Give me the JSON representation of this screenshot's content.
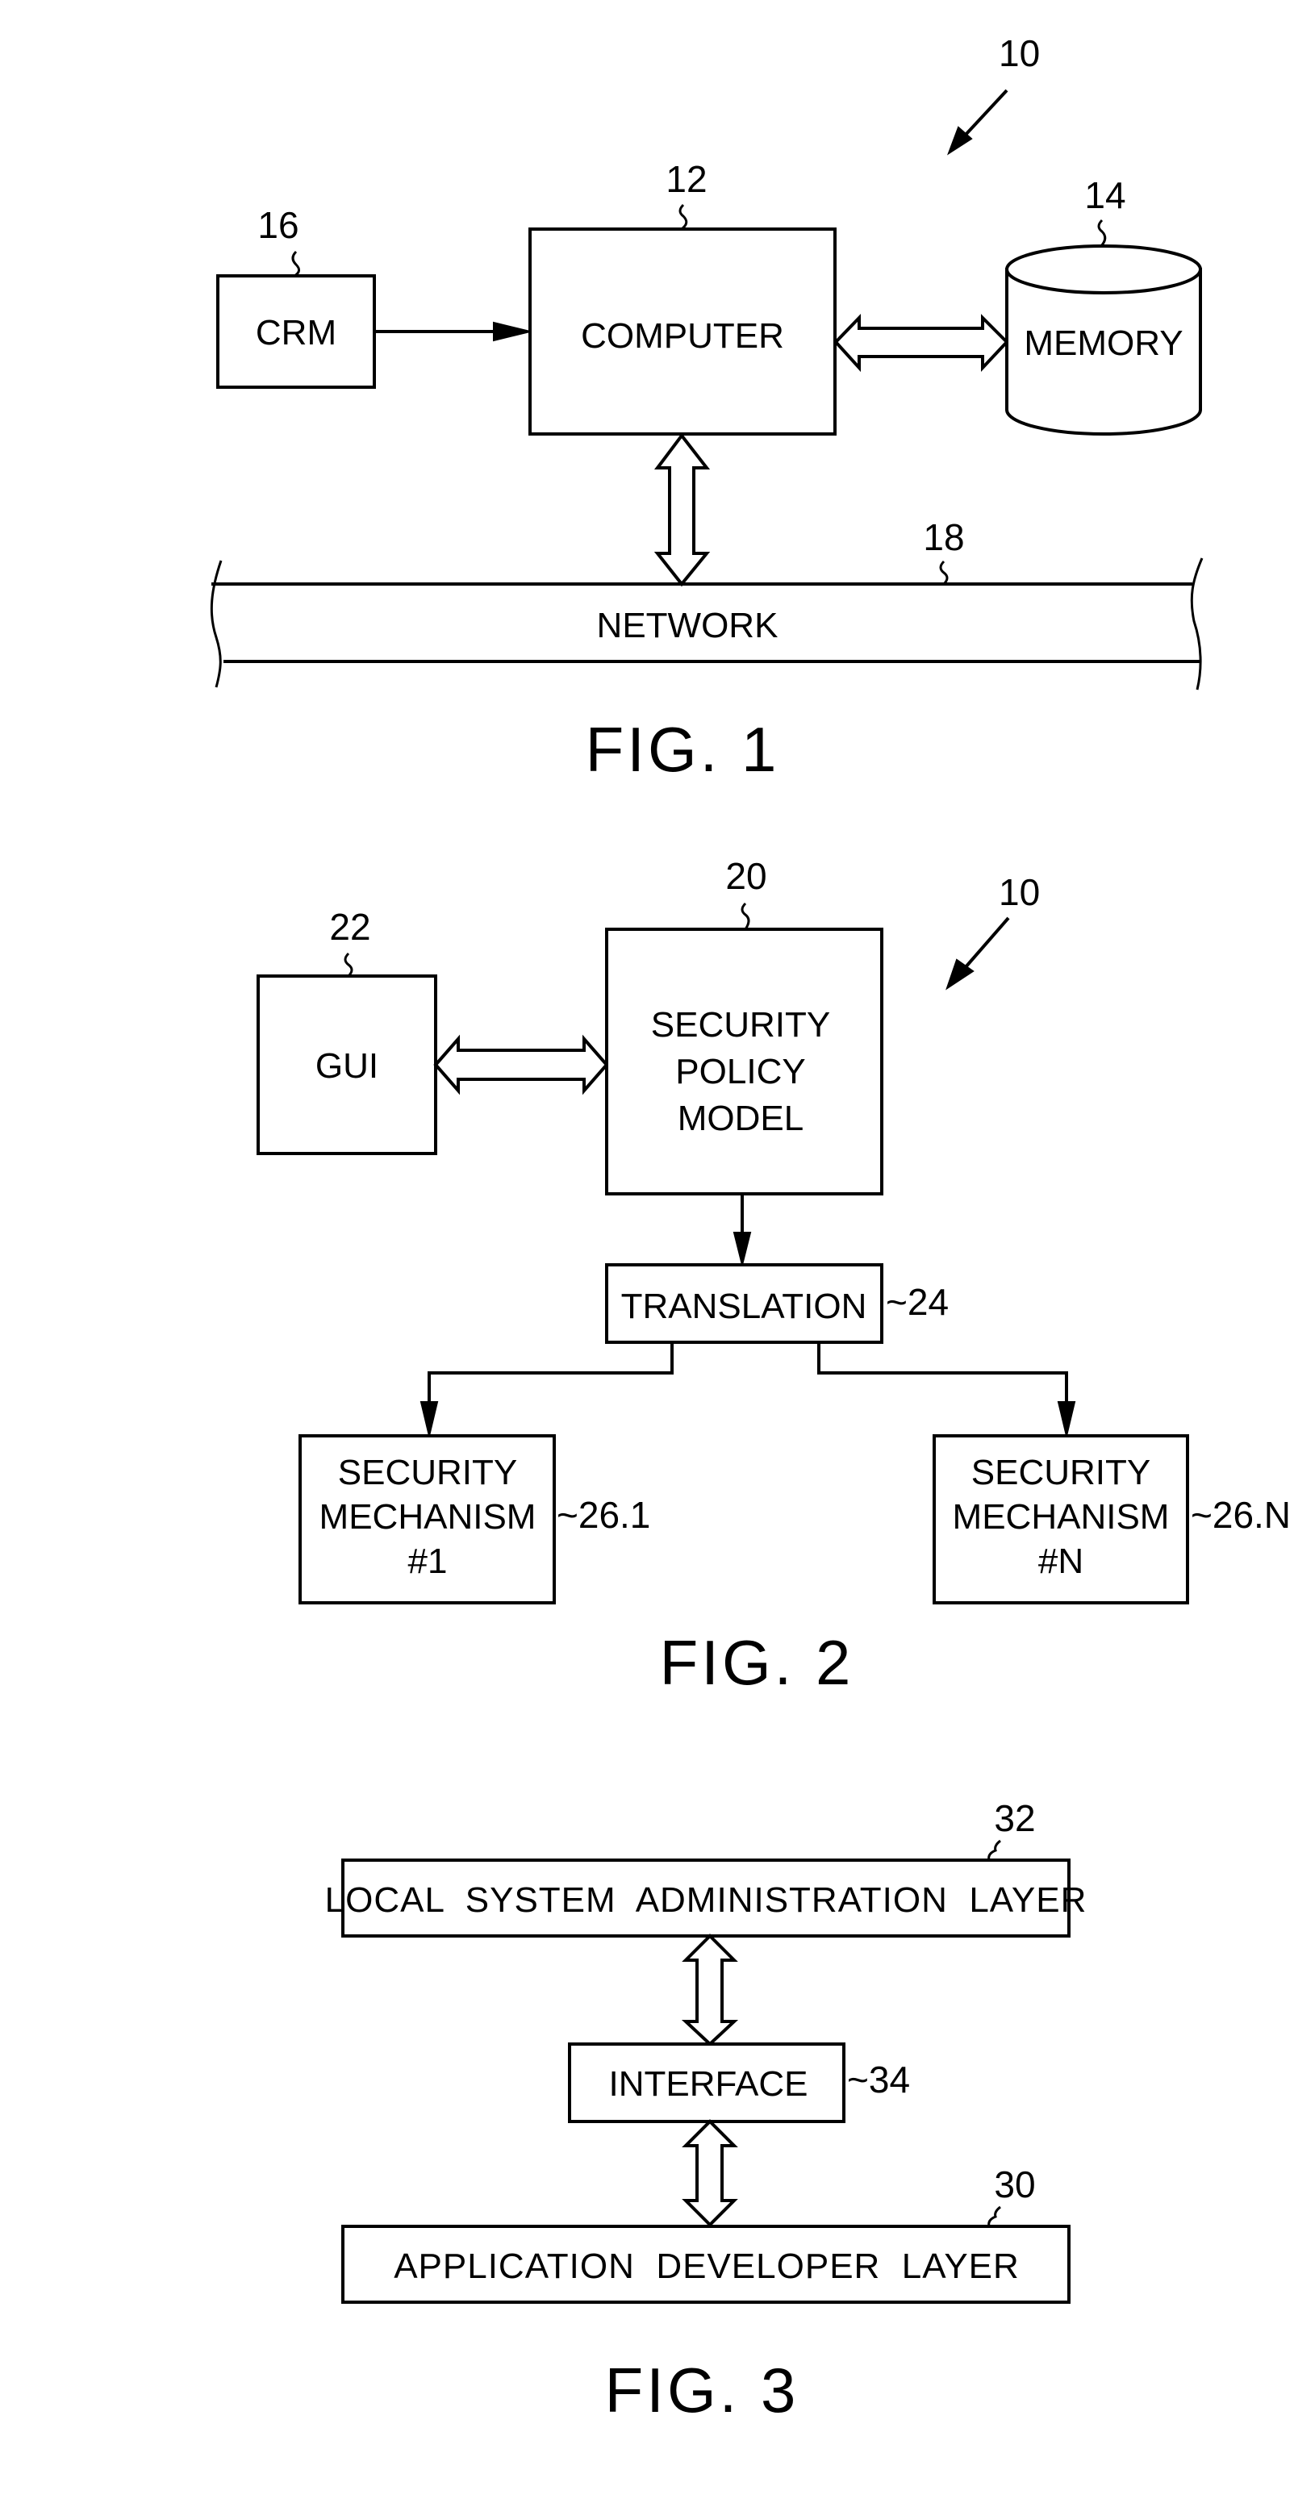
{
  "fig1": {
    "caption": "FIG. 1",
    "system_ref": "10",
    "crm": {
      "label": "CRM",
      "ref": "16"
    },
    "computer": {
      "label": "COMPUTER",
      "ref": "12"
    },
    "memory": {
      "label": "MEMORY",
      "ref": "14"
    },
    "network": {
      "label": "NETWORK",
      "ref": "18"
    }
  },
  "fig2": {
    "caption": "FIG. 2",
    "system_ref": "10",
    "gui": {
      "label": "GUI",
      "ref": "22"
    },
    "policy_model": {
      "lines": [
        "SECURITY",
        "POLICY",
        "MODEL"
      ],
      "ref": "20"
    },
    "translation": {
      "label": "TRANSLATION",
      "ref": "~24"
    },
    "mechanism_1": {
      "lines": [
        "SECURITY",
        "MECHANISM",
        "#1"
      ],
      "ref": "~26.1"
    },
    "mechanism_n": {
      "lines": [
        "SECURITY",
        "MECHANISM",
        "#N"
      ],
      "ref": "~26.N"
    }
  },
  "fig3": {
    "caption": "FIG. 3",
    "local_admin_layer": {
      "label": "LOCAL  SYSTEM  ADMINISTRATION  LAYER",
      "ref": "32"
    },
    "interface": {
      "label": "INTERFACE",
      "ref": "~34"
    },
    "app_dev_layer": {
      "label": "APPLICATION  DEVELOPER  LAYER",
      "ref": "30"
    }
  }
}
